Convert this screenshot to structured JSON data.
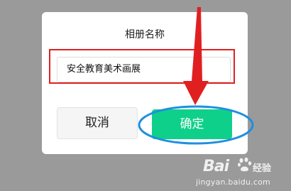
{
  "dialog": {
    "title": "相册名称",
    "input_value": "安全教育美术画展",
    "cancel_label": "取消",
    "confirm_label": "确定"
  },
  "colors": {
    "confirm_button": "#0fd08a",
    "annotation_red": "#e02020",
    "annotation_blue": "#1f8fe0",
    "backdrop": "#9a9a9a"
  },
  "watermark": {
    "logo_text": "Bai",
    "logo_text_2": "经验",
    "url": "jingyan.baidu.com"
  }
}
